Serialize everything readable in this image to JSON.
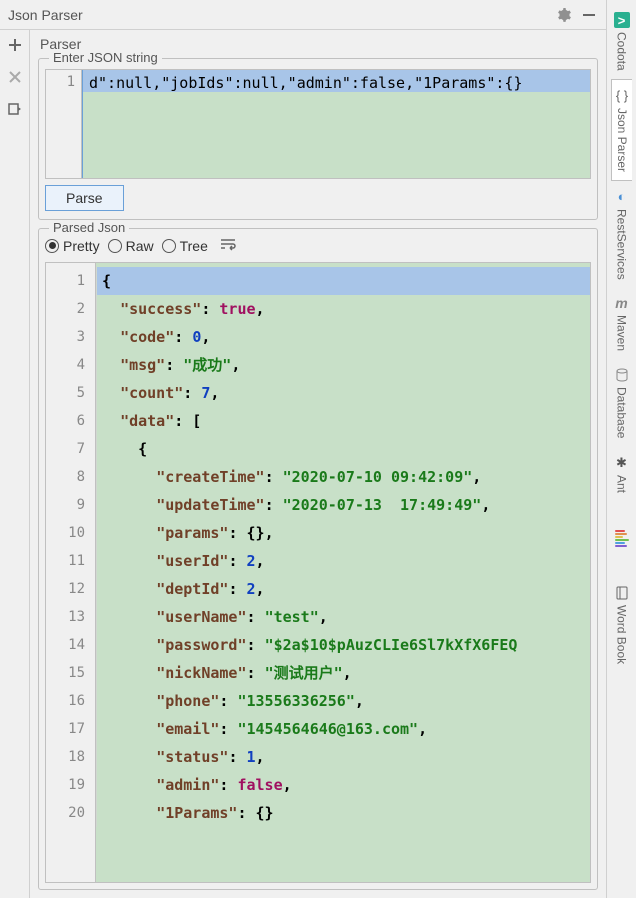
{
  "title": "Json Parser",
  "parser_tab": "Parser",
  "input": {
    "section_label": "Enter JSON string",
    "gutter": "1",
    "content": "d\":null,\"jobIds\":null,\"admin\":false,\"1Params\":{}"
  },
  "parse_button": "Parse",
  "parsed": {
    "section_label": "Parsed Json",
    "views": {
      "pretty": "Pretty",
      "raw": "Raw",
      "tree": "Tree"
    }
  },
  "output_gutter": [
    "1",
    "2",
    "3",
    "4",
    "5",
    "6",
    "7",
    "8",
    "9",
    "10",
    "11",
    "12",
    "13",
    "14",
    "15",
    "16",
    "17",
    "18",
    "19",
    "20"
  ],
  "code": {
    "l1": "{",
    "l2k": "\"success\"",
    "l2v": "true",
    "l3k": "\"code\"",
    "l3v": "0",
    "l4k": "\"msg\"",
    "l4v": "\"成功\"",
    "l5k": "\"count\"",
    "l5v": "7",
    "l6k": "\"data\"",
    "l7": "{",
    "l8k": "\"createTime\"",
    "l8v": "\"2020-07-10 09:42:09\"",
    "l9k": "\"updateTime\"",
    "l9v": "\"2020-07-13  17:49:49\"",
    "l10k": "\"params\"",
    "l10v": "{}",
    "l11k": "\"userId\"",
    "l11v": "2",
    "l12k": "\"deptId\"",
    "l12v": "2",
    "l13k": "\"userName\"",
    "l13v": "\"test\"",
    "l14k": "\"password\"",
    "l14v": "\"$2a$10$pAuzCLIe6Sl7kXfX6FEQ",
    "l15k": "\"nickName\"",
    "l15v": "\"测试用户\"",
    "l16k": "\"phone\"",
    "l16v": "\"13556336256\"",
    "l17k": "\"email\"",
    "l17v": "\"1454564646@163.com\"",
    "l18k": "\"status\"",
    "l18v": "1",
    "l19k": "\"admin\"",
    "l19v": "false",
    "l20k": "\"1Params\"",
    "l20v": "{}"
  },
  "right_tools": {
    "codota": "Codota",
    "json_parser": "Json Parser",
    "rest": "RestServices",
    "maven": "Maven",
    "database": "Database",
    "ant": "Ant",
    "wordbook": "Word Book"
  }
}
